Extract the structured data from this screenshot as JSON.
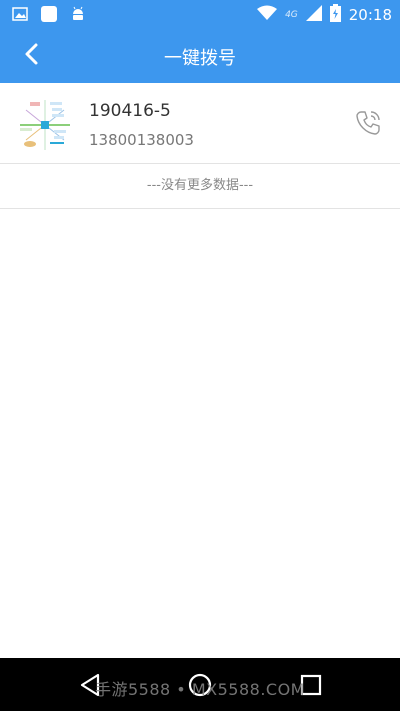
{
  "status_bar": {
    "time": "20:18",
    "network": "4G",
    "colors": {
      "bar": "#3d97ee"
    },
    "icons": [
      "image-icon",
      "app-icon",
      "android-icon",
      "wifi-icon",
      "signal-icon",
      "battery-icon"
    ]
  },
  "header": {
    "title": "一键拨号",
    "back_icon": "chevron-left-icon"
  },
  "contacts": [
    {
      "name": "190416-5",
      "phone": "13800138003",
      "action_icon": "phone-call-icon"
    }
  ],
  "list_footer": "---没有更多数据---",
  "nav_bar": {
    "icons": [
      "back-triangle-icon",
      "home-circle-icon",
      "recents-square-icon"
    ],
    "watermark": "手游5588 • MX5588.COM"
  }
}
